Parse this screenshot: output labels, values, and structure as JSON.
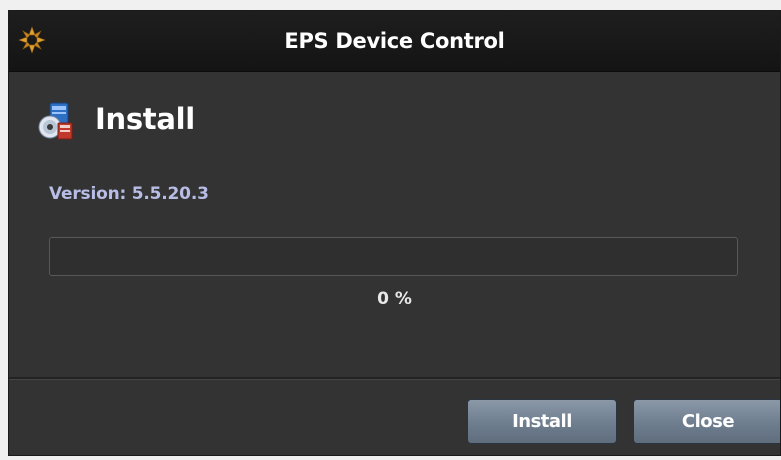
{
  "window": {
    "title": "EPS Device Control",
    "app_icon": "starburst-app-icon"
  },
  "content": {
    "heading": "Install",
    "heading_icon": "installer-package-icon",
    "version_text": "Version: 5.5.20.3",
    "progress": {
      "fraction": 0,
      "percent_label": "0 %"
    }
  },
  "buttons": {
    "install_label": "Install",
    "close_label": "Close"
  },
  "colors": {
    "window_bg": "#333333",
    "titlebar_bg": "#1a1a1a",
    "version_text": "#b8bde6",
    "button_bg": "#75859a"
  }
}
